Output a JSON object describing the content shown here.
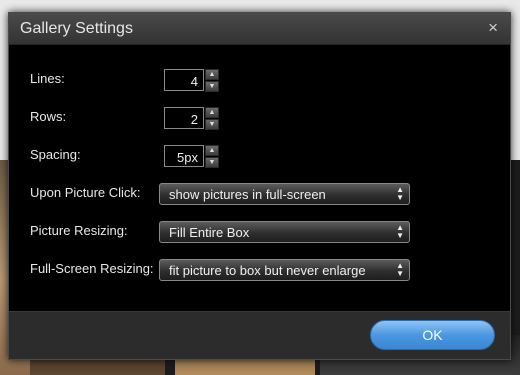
{
  "dialog": {
    "title": "Gallery Settings",
    "close_glyph": "×"
  },
  "fields": {
    "lines": {
      "label": "Lines:",
      "value": "4"
    },
    "rows": {
      "label": "Rows:",
      "value": "2"
    },
    "spacing": {
      "label": "Spacing:",
      "value": "5px"
    },
    "upon_click": {
      "label": "Upon Picture Click:",
      "selected": "show pictures in full-screen"
    },
    "resizing": {
      "label": "Picture Resizing:",
      "selected": "Fill Entire Box"
    },
    "fullscreen_resizing": {
      "label": "Full-Screen Resizing:",
      "selected": "fit picture to box but never enlarge"
    }
  },
  "footer": {
    "ok_label": "OK"
  },
  "icons": {
    "up": "chevron-up-icon",
    "down": "chevron-down-icon",
    "close": "close-icon"
  },
  "colors": {
    "ok_button": "#4c97e0",
    "dialog_bg": "#000000",
    "footer_bg": "#2c2c2c"
  }
}
